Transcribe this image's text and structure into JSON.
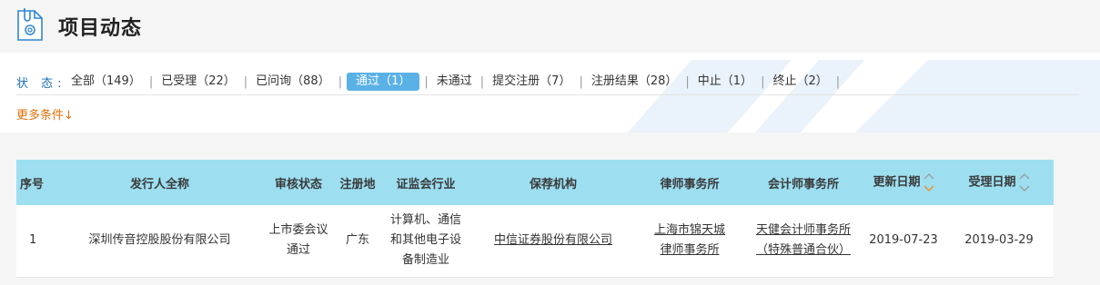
{
  "header": {
    "title": "项目动态"
  },
  "filters": {
    "label": "状 态:",
    "items": [
      {
        "label": "全部（149）",
        "active": false
      },
      {
        "label": "已受理（22）",
        "active": false
      },
      {
        "label": "已问询（88）",
        "active": false
      },
      {
        "label": "通过（1）",
        "active": true
      },
      {
        "label": "未通过",
        "active": false
      },
      {
        "label": "提交注册（7）",
        "active": false
      },
      {
        "label": "注册结果（28）",
        "active": false
      },
      {
        "label": "中止（1）",
        "active": false
      },
      {
        "label": "终止（2）",
        "active": false
      }
    ],
    "separator": "|",
    "more": "更多条件↓"
  },
  "table": {
    "columns": [
      "序号",
      "发行人全称",
      "审核状态",
      "注册地",
      "证监会行业",
      "保荐机构",
      "律师事务所",
      "会计师事务所",
      "更新日期",
      "受理日期"
    ],
    "rows": [
      {
        "index": "1",
        "issuer": "深圳传音控股股份有限公司",
        "status_line1": "上市委会议",
        "status_line2": "通过",
        "region": "广东",
        "industry_line1": "计算机、通信",
        "industry_line2": "和其他电子设",
        "industry_line3": "备制造业",
        "sponsor": "中信证券股份有限公司",
        "law_firm_line1": "上海市锦天城",
        "law_firm_line2": "律师事务所",
        "accountant_line1": "天健会计师事务所",
        "accountant_line2": "（特殊普通合伙）",
        "updated": "2019-07-23",
        "accepted": "2019-03-29"
      }
    ]
  },
  "colors": {
    "accent_blue": "#1b6fb5",
    "active_tab": "#5ab1e6",
    "table_header": "#9ddff1",
    "orange": "#e2700b"
  }
}
